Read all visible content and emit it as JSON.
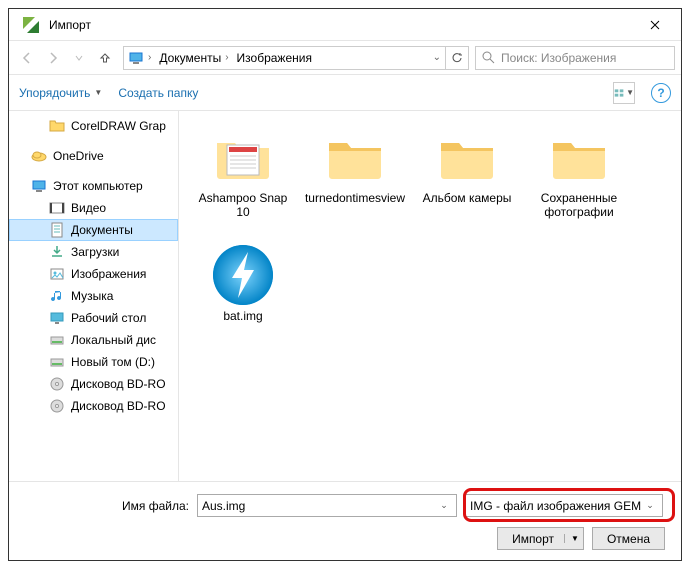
{
  "window": {
    "title": "Импорт"
  },
  "nav": {
    "crumbs": [
      "Документы",
      "Изображения"
    ],
    "search_placeholder": "Поиск: Изображения"
  },
  "cmd": {
    "organize": "Упорядочить",
    "newfolder": "Создать папку"
  },
  "tree": {
    "items": [
      {
        "label": "CorelDRAW Grap",
        "icon": "folder",
        "level": 1
      },
      {
        "label": "OneDrive",
        "icon": "onedrive",
        "level": 0,
        "gap": true
      },
      {
        "label": "Этот компьютер",
        "icon": "pc",
        "level": 0,
        "gap": true
      },
      {
        "label": "Видео",
        "icon": "video",
        "level": 1
      },
      {
        "label": "Документы",
        "icon": "doc",
        "level": 1,
        "sel": true
      },
      {
        "label": "Загрузки",
        "icon": "download",
        "level": 1
      },
      {
        "label": "Изображения",
        "icon": "image",
        "level": 1
      },
      {
        "label": "Музыка",
        "icon": "music",
        "level": 1
      },
      {
        "label": "Рабочий стол",
        "icon": "desktop",
        "level": 1
      },
      {
        "label": "Локальный дис",
        "icon": "disk",
        "level": 1
      },
      {
        "label": "Новый том (D:)",
        "icon": "disk",
        "level": 1
      },
      {
        "label": "Дисковод BD-RO",
        "icon": "bd",
        "level": 1
      },
      {
        "label": "Дисковод BD-RO",
        "icon": "bd",
        "level": 1
      }
    ]
  },
  "files": [
    {
      "label": "Ashampoo Snap 10",
      "kind": "app"
    },
    {
      "label": "turnedontimesview",
      "kind": "folder"
    },
    {
      "label": "Альбом камеры",
      "kind": "folder"
    },
    {
      "label": "Сохраненные фотографии",
      "kind": "folder"
    },
    {
      "label": "bat.img",
      "kind": "daemon"
    }
  ],
  "bottom": {
    "fname_label": "Имя файла:",
    "fname_value": "Aus.img",
    "ftype_value": "IMG - файл изображения GEM",
    "import": "Импорт",
    "cancel": "Отмена"
  }
}
